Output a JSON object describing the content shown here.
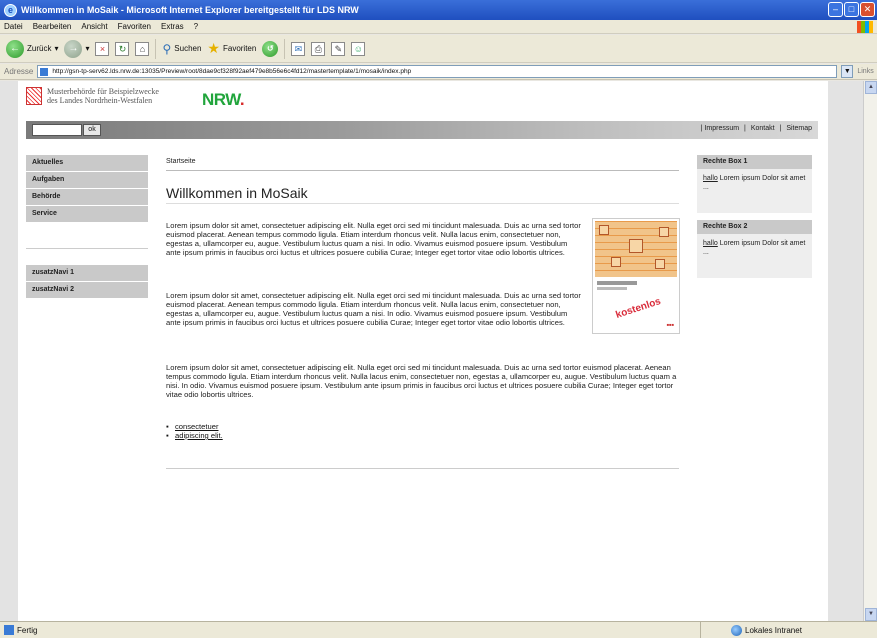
{
  "window": {
    "title": "Willkommen in MoSaik - Microsoft Internet Explorer bereitgestellt für LDS NRW"
  },
  "menu": [
    "Datei",
    "Bearbeiten",
    "Ansicht",
    "Favoriten",
    "Extras",
    "?"
  ],
  "toolbar": {
    "back_label": "Zurück",
    "search_label": "Suchen",
    "favorites_label": "Favoriten"
  },
  "address": {
    "label": "Adresse",
    "url": "http://gsn-tp-serv62.lds.nrw.de:13035/Preview/root/8dae9cf328f92aef479e8b56e6c4fd12/mastertemplate/1/mosaik/index.php",
    "go_label": "Links"
  },
  "status": {
    "left": "Fertig",
    "zone": "Lokales Intranet"
  },
  "site": {
    "logo_line1": "Musterbehörde für Beispielzwecke",
    "logo_line2": "des Landes Nordrhein-Westfalen",
    "nrw": "NRW",
    "nrw_dot": ".",
    "search_button": "ok",
    "meta_links": [
      "Impressum",
      "Kontakt",
      "Sitemap"
    ],
    "meta_sep": "|"
  },
  "leftnav": {
    "main": [
      "Aktuelles",
      "Aufgaben",
      "Behörde",
      "Service"
    ],
    "extra": [
      "zusatzNavi 1",
      "zusatzNavi 2"
    ]
  },
  "content": {
    "breadcrumb": "Startseite",
    "title": "Willkommen in MoSaik",
    "p1": "Lorem ipsum dolor sit amet, consectetuer adipiscing elit. Nulla eget orci sed mi tincidunt malesuada. Duis ac urna sed tortor euismod placerat. Aenean tempus commodo ligula. Etiam interdum rhoncus velit. Nulla lacus enim, consectetuer non, egestas a, ullamcorper eu, augue. Vestibulum luctus quam a nisi. In odio. Vivamus euismod posuere ipsum. Vestibulum ante ipsum primis in faucibus orci luctus et ultrices posuere cubilia Curae; Integer eget tortor vitae odio lobortis ultrices.",
    "p2": "Lorem ipsum dolor sit amet, consectetuer adipiscing elit. Nulla eget orci sed mi tincidunt malesuada. Duis ac urna sed tortor euismod placerat. Aenean tempus commodo ligula. Etiam interdum rhoncus velit. Nulla lacus enim, consectetuer non, egestas a, ullamcorper eu, augue. Vestibulum luctus quam a nisi. In odio. Vivamus euismod posuere ipsum. Vestibulum ante ipsum primis in faucibus orci luctus et ultrices posuere cubilia Curae; Integer eget tortor vitae odio lobortis ultrices.",
    "p3": "Lorem ipsum dolor sit amet, consectetuer adipiscing elit. Nulla eget orci sed mi tincidunt malesuada. Duis ac urna sed tortor euismod placerat. Aenean tempus commodo ligula. Etiam interdum rhoncus velit. Nulla lacus enim, consectetuer non, egestas a, ullamcorper eu, augue. Vestibulum luctus quam a nisi. In odio. Vivamus euismod posuere ipsum. Vestibulum ante ipsum primis in faucibus orci luctus et ultrices posuere cubilia Curae; Integer eget tortor vitae odio lobortis ultrices.",
    "links": [
      "consectetuer",
      "adipiscing elit."
    ],
    "book_stamp": "kostenlos"
  },
  "rightboxes": [
    {
      "title": "Rechte Box 1",
      "link": "hallo",
      "text": " Lorem ipsum Dolor sit amet ..."
    },
    {
      "title": "Rechte Box 2",
      "link": "hallo",
      "text": " Lorem ipsum Dolor sit amet ..."
    }
  ]
}
